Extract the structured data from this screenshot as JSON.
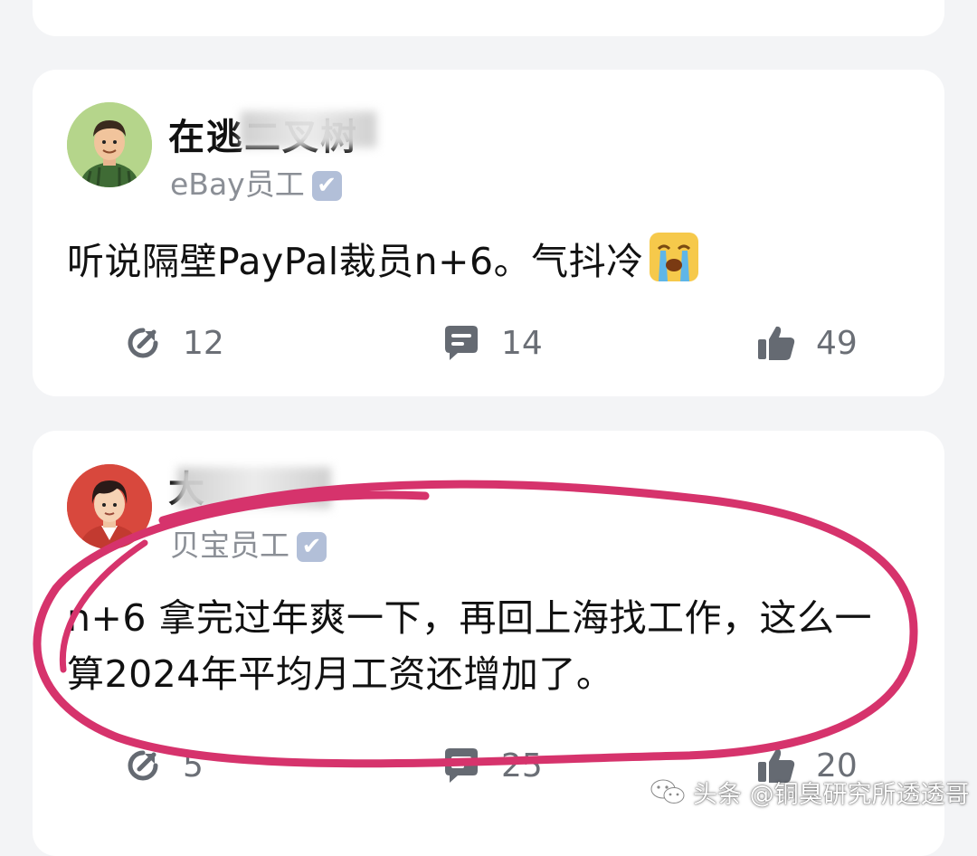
{
  "posts": [
    {
      "author": "在逃二叉树",
      "company": "eBay员工",
      "verified_mark": "✔",
      "text": "听说隔壁PayPal裁员n+6。气抖冷",
      "emoji": "crying-face",
      "shares": "12",
      "comments": "14",
      "likes": "49"
    },
    {
      "author": "大",
      "company": "贝宝员工",
      "verified_mark": "✔",
      "text": "n+6 拿完过年爽一下，再回上海找工作，这么一算2024年平均月工资还增加了。",
      "shares": "5",
      "comments": "25",
      "likes": "20"
    }
  ],
  "watermark": "头条 @铜臭研究所透透哥",
  "icons": {
    "share": "share-icon",
    "comment": "comment-icon",
    "like": "thumbs-up-icon",
    "wechat": "wechat-icon"
  },
  "colors": {
    "circle": "#d6336c",
    "icon": "#656a72",
    "verified": "#b2bfd8"
  }
}
